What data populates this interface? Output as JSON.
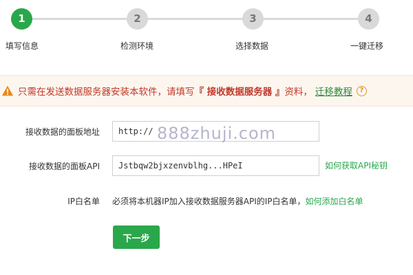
{
  "steps": [
    {
      "number": "1",
      "label": "填写信息",
      "active": true
    },
    {
      "number": "2",
      "label": "检测环境",
      "active": false
    },
    {
      "number": "3",
      "label": "选择数据",
      "active": false
    },
    {
      "number": "4",
      "label": "一键迁移",
      "active": false
    }
  ],
  "warning": {
    "text_prefix": "只需在发送数据服务器安装本软件，请填写",
    "strong": "『 接收数据服务器 』",
    "text_suffix": "资料，",
    "link": "迁移教程",
    "help": "?"
  },
  "form": {
    "panel_url_label": "接收数据的面板地址",
    "panel_url_value": "http://",
    "panel_api_label": "接收数据的面板API",
    "panel_api_value": "Jstbqw2bjxzenvblhg...HPeI",
    "api_help_link": "如何获取API秘钥",
    "ip_label": "IP白名单",
    "ip_text": "必须将本机器IP加入接收数据服务器API的IP白名单，",
    "ip_link": "如何添加白名单"
  },
  "next_button": "下一步",
  "watermark": "888zhuji.com",
  "colors": {
    "accent": "#2aa74b",
    "warning": "#c0392b",
    "inactive": "#d9d9d9"
  }
}
